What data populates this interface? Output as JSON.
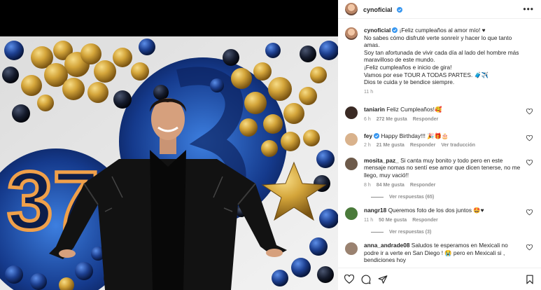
{
  "post": {
    "username": "cynoficial",
    "more_label": "•••"
  },
  "caption": {
    "username": "cynoficial",
    "text": "¡Feliz cumpleaños al amor mío! ♥\nNo sabes cómo disfruté verte sonreír y hacer lo que tanto amas.\nSoy tan afortunada de vivir cada día al lado del hombre más maravilloso de este mundo.\n¡Feliz cumpleaños e inicio de gira!\nVamos por ese TOUR A TODAS PARTES. 🧳✈️\nDios te cuida y te bendice siempre.",
    "time": "11 h"
  },
  "photo": {
    "number_text": "37"
  },
  "comments": [
    {
      "username": "taniarin",
      "text": "Feliz Cumpleaños!🥰",
      "time": "6 h",
      "likes": "272 Me gusta",
      "reply": "Responder",
      "avatar_color": "#3a2a24"
    },
    {
      "username": "fey",
      "text": "Happy Birthday!!! 🎉🎁🎂",
      "time": "2 h",
      "likes": "21 Me gusta",
      "reply": "Responder",
      "translate": "Ver traducción",
      "avatar_color": "#d9b28c"
    },
    {
      "username": "mosita_paz_",
      "text": "Si canta muy bonito y todo pero en este mensaje nomas no sentí ese amor que dicen tenerse, no me llego, muy vació!!",
      "time": "8 h",
      "likes": "84 Me gusta",
      "reply": "Responder",
      "view_replies": "Ver respuestas (65)",
      "avatar_color": "#6d5a4a"
    },
    {
      "username": "nangr18",
      "text": "Queremos foto de los dos juntos 🤩♥",
      "time": "11 h",
      "likes": "50 Me gusta",
      "reply": "Responder",
      "view_replies": "Ver respuestas (3)",
      "avatar_color": "#4a7a3a"
    },
    {
      "username": "anna_andrade08",
      "text": "Saludos te esperamos en Mexicali no podre ir a verte en San Diego ! 😭 pero en Mexicali si , bendiciones hoy",
      "avatar_color": "#9a8270"
    }
  ],
  "colors": {
    "verified": "#3897f0",
    "heart": "#ed4956",
    "balloon_gold": "#d4a53a",
    "balloon_blue": "#1d3f8f",
    "backdrop": "#142a6b"
  },
  "icons": {
    "like": "heart-icon",
    "comment": "comment-icon",
    "share": "share-icon",
    "save": "bookmark-icon"
  }
}
